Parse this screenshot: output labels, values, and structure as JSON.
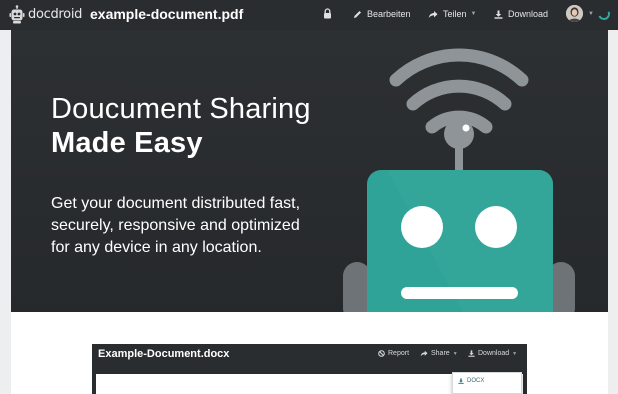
{
  "app": {
    "logo_text": "docdroid",
    "document_title": "example-document.pdf"
  },
  "nav": {
    "lock_icon": "lock-icon",
    "edit_label": "Bearbeiten",
    "share_label": "Teilen",
    "download_label": "Download"
  },
  "hero": {
    "title_line1": "Doucument Sharing",
    "title_line2": "Made Easy",
    "text": "Get your document distributed fast, securely, responsive and optimized for any device in any location."
  },
  "viewer": {
    "title": "Example-Document.docx",
    "report_label": "Report",
    "share_label": "Share",
    "download_label": "Download",
    "dropdown_items": [
      "DOCX"
    ]
  },
  "colors": {
    "navbar": "#2a2d30",
    "robot_teal": "#2fa397",
    "accent": "#35a79c"
  }
}
